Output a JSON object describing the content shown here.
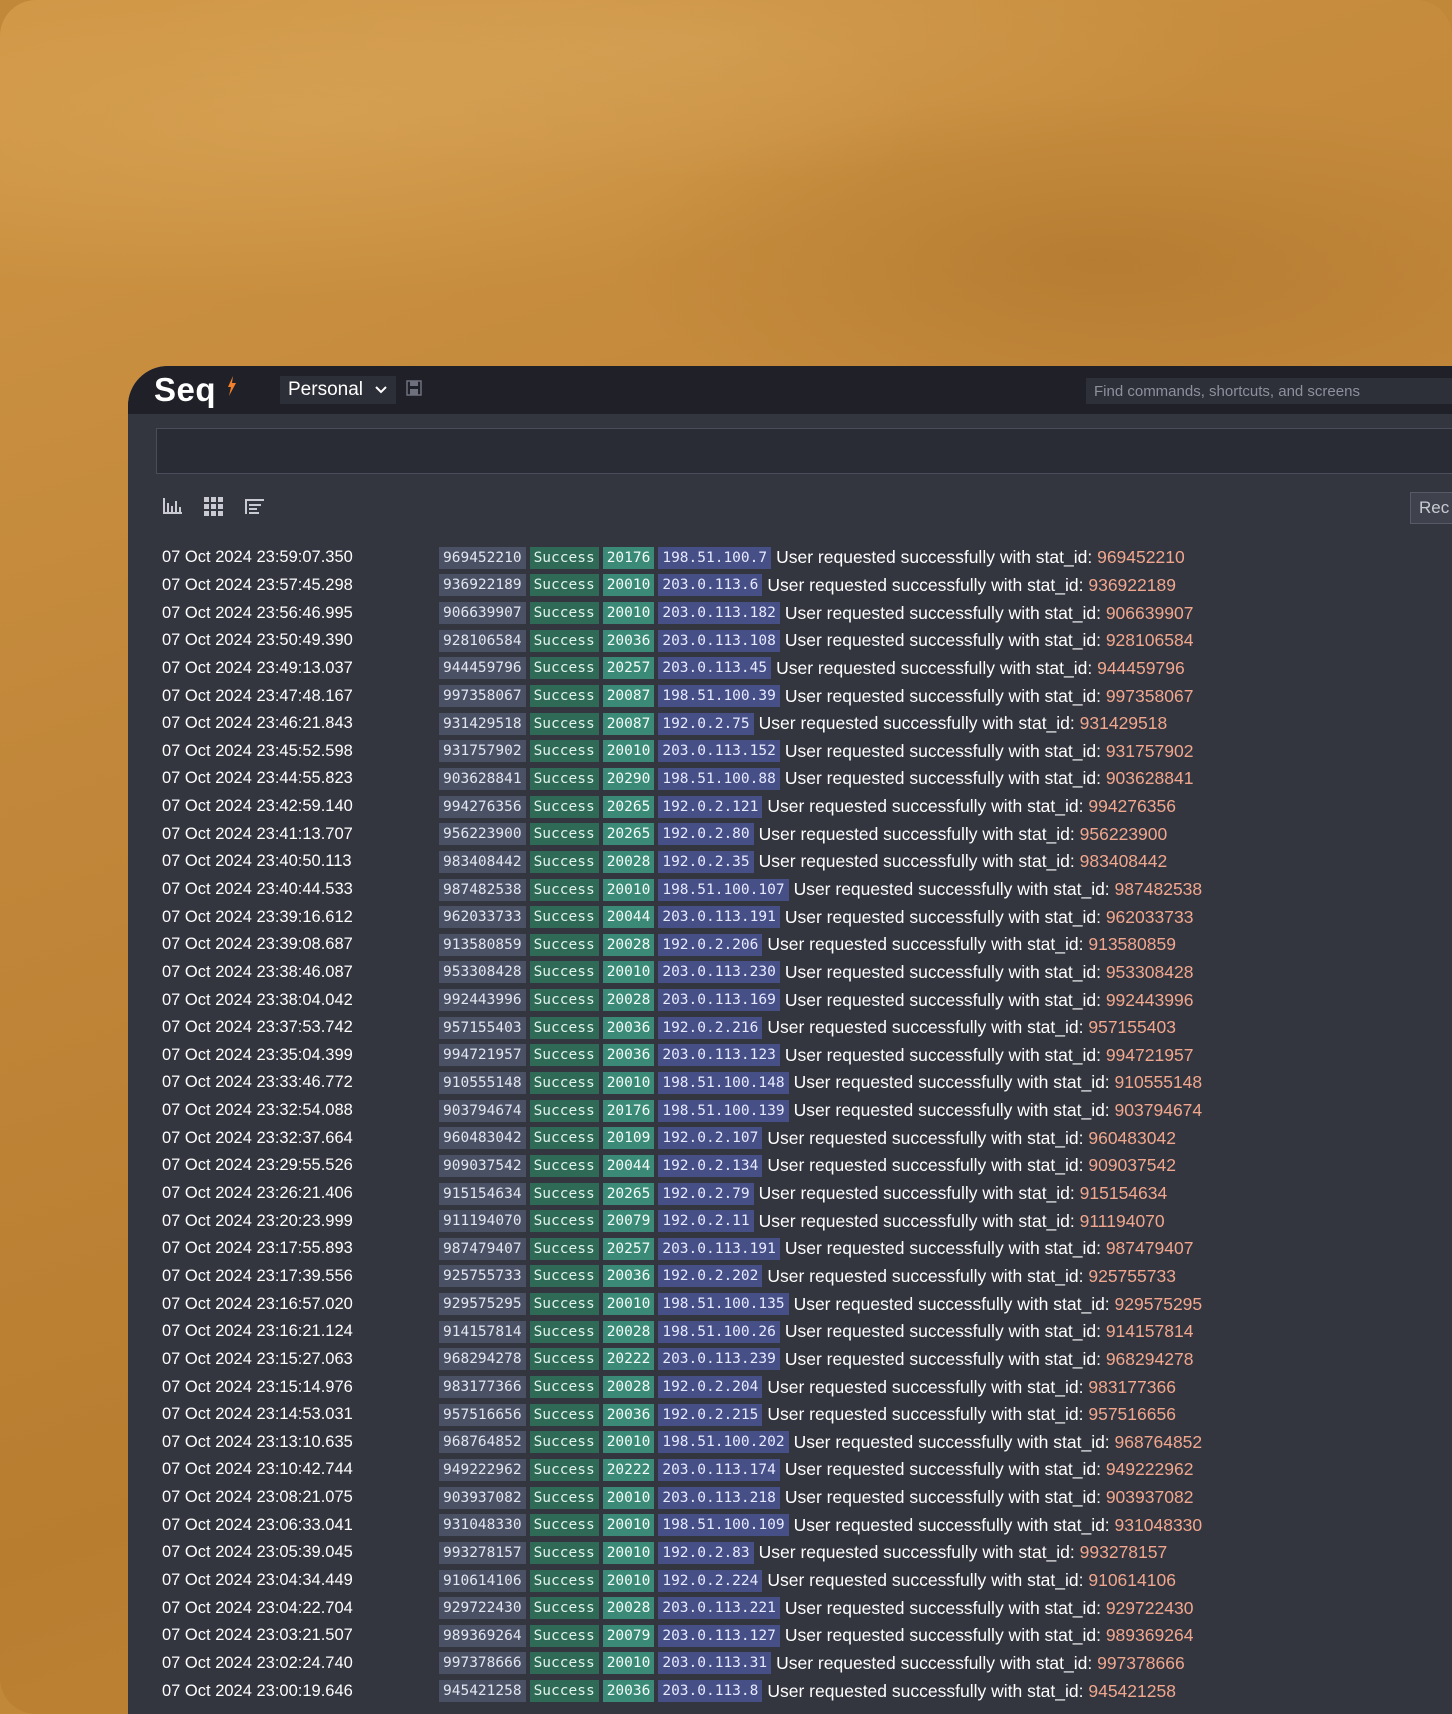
{
  "app": {
    "logo_text": "Seq",
    "workspace": "Personal",
    "search_placeholder": "Find commands, shortcuts, and screens",
    "filter_value": "",
    "rec_label": "Rec"
  },
  "colors": {
    "background": "#c2883a",
    "window": "#33353f",
    "topbar": "#1f2028",
    "id_pill": "#4a5164",
    "status_pill": "#2f6a57",
    "code_pill": "#3b8a77",
    "ip_pill": "#464f86",
    "number_accent": "#f0a78d",
    "logo_accent": "#f2802b"
  },
  "icons": [
    "bar-chart-icon",
    "grid-icon",
    "list-tree-icon",
    "save-icon",
    "chevron-down-icon"
  ],
  "message_prefix": "User requested successfully with stat_id: ",
  "events": [
    {
      "time": "07 Oct 2024  23:59:07.350",
      "id": "969452210",
      "status": "Success",
      "code": "20176",
      "ip": "198.51.100.7"
    },
    {
      "time": "07 Oct 2024  23:57:45.298",
      "id": "936922189",
      "status": "Success",
      "code": "20010",
      "ip": "203.0.113.6"
    },
    {
      "time": "07 Oct 2024  23:56:46.995",
      "id": "906639907",
      "status": "Success",
      "code": "20010",
      "ip": "203.0.113.182"
    },
    {
      "time": "07 Oct 2024  23:50:49.390",
      "id": "928106584",
      "status": "Success",
      "code": "20036",
      "ip": "203.0.113.108"
    },
    {
      "time": "07 Oct 2024  23:49:13.037",
      "id": "944459796",
      "status": "Success",
      "code": "20257",
      "ip": "203.0.113.45"
    },
    {
      "time": "07 Oct 2024  23:47:48.167",
      "id": "997358067",
      "status": "Success",
      "code": "20087",
      "ip": "198.51.100.39"
    },
    {
      "time": "07 Oct 2024  23:46:21.843",
      "id": "931429518",
      "status": "Success",
      "code": "20087",
      "ip": "192.0.2.75"
    },
    {
      "time": "07 Oct 2024  23:45:52.598",
      "id": "931757902",
      "status": "Success",
      "code": "20010",
      "ip": "203.0.113.152"
    },
    {
      "time": "07 Oct 2024  23:44:55.823",
      "id": "903628841",
      "status": "Success",
      "code": "20290",
      "ip": "198.51.100.88"
    },
    {
      "time": "07 Oct 2024  23:42:59.140",
      "id": "994276356",
      "status": "Success",
      "code": "20265",
      "ip": "192.0.2.121"
    },
    {
      "time": "07 Oct 2024  23:41:13.707",
      "id": "956223900",
      "status": "Success",
      "code": "20265",
      "ip": "192.0.2.80"
    },
    {
      "time": "07 Oct 2024  23:40:50.113",
      "id": "983408442",
      "status": "Success",
      "code": "20028",
      "ip": "192.0.2.35"
    },
    {
      "time": "07 Oct 2024  23:40:44.533",
      "id": "987482538",
      "status": "Success",
      "code": "20010",
      "ip": "198.51.100.107"
    },
    {
      "time": "07 Oct 2024  23:39:16.612",
      "id": "962033733",
      "status": "Success",
      "code": "20044",
      "ip": "203.0.113.191"
    },
    {
      "time": "07 Oct 2024  23:39:08.687",
      "id": "913580859",
      "status": "Success",
      "code": "20028",
      "ip": "192.0.2.206"
    },
    {
      "time": "07 Oct 2024  23:38:46.087",
      "id": "953308428",
      "status": "Success",
      "code": "20010",
      "ip": "203.0.113.230"
    },
    {
      "time": "07 Oct 2024  23:38:04.042",
      "id": "992443996",
      "status": "Success",
      "code": "20028",
      "ip": "203.0.113.169"
    },
    {
      "time": "07 Oct 2024  23:37:53.742",
      "id": "957155403",
      "status": "Success",
      "code": "20036",
      "ip": "192.0.2.216"
    },
    {
      "time": "07 Oct 2024  23:35:04.399",
      "id": "994721957",
      "status": "Success",
      "code": "20036",
      "ip": "203.0.113.123"
    },
    {
      "time": "07 Oct 2024  23:33:46.772",
      "id": "910555148",
      "status": "Success",
      "code": "20010",
      "ip": "198.51.100.148"
    },
    {
      "time": "07 Oct 2024  23:32:54.088",
      "id": "903794674",
      "status": "Success",
      "code": "20176",
      "ip": "198.51.100.139"
    },
    {
      "time": "07 Oct 2024  23:32:37.664",
      "id": "960483042",
      "status": "Success",
      "code": "20109",
      "ip": "192.0.2.107"
    },
    {
      "time": "07 Oct 2024  23:29:55.526",
      "id": "909037542",
      "status": "Success",
      "code": "20044",
      "ip": "192.0.2.134"
    },
    {
      "time": "07 Oct 2024  23:26:21.406",
      "id": "915154634",
      "status": "Success",
      "code": "20265",
      "ip": "192.0.2.79"
    },
    {
      "time": "07 Oct 2024  23:20:23.999",
      "id": "911194070",
      "status": "Success",
      "code": "20079",
      "ip": "192.0.2.11"
    },
    {
      "time": "07 Oct 2024  23:17:55.893",
      "id": "987479407",
      "status": "Success",
      "code": "20257",
      "ip": "203.0.113.191"
    },
    {
      "time": "07 Oct 2024  23:17:39.556",
      "id": "925755733",
      "status": "Success",
      "code": "20036",
      "ip": "192.0.2.202"
    },
    {
      "time": "07 Oct 2024  23:16:57.020",
      "id": "929575295",
      "status": "Success",
      "code": "20010",
      "ip": "198.51.100.135"
    },
    {
      "time": "07 Oct 2024  23:16:21.124",
      "id": "914157814",
      "status": "Success",
      "code": "20028",
      "ip": "198.51.100.26"
    },
    {
      "time": "07 Oct 2024  23:15:27.063",
      "id": "968294278",
      "status": "Success",
      "code": "20222",
      "ip": "203.0.113.239"
    },
    {
      "time": "07 Oct 2024  23:15:14.976",
      "id": "983177366",
      "status": "Success",
      "code": "20028",
      "ip": "192.0.2.204"
    },
    {
      "time": "07 Oct 2024  23:14:53.031",
      "id": "957516656",
      "status": "Success",
      "code": "20036",
      "ip": "192.0.2.215"
    },
    {
      "time": "07 Oct 2024  23:13:10.635",
      "id": "968764852",
      "status": "Success",
      "code": "20010",
      "ip": "198.51.100.202"
    },
    {
      "time": "07 Oct 2024  23:10:42.744",
      "id": "949222962",
      "status": "Success",
      "code": "20222",
      "ip": "203.0.113.174"
    },
    {
      "time": "07 Oct 2024  23:08:21.075",
      "id": "903937082",
      "status": "Success",
      "code": "20010",
      "ip": "203.0.113.218"
    },
    {
      "time": "07 Oct 2024  23:06:33.041",
      "id": "931048330",
      "status": "Success",
      "code": "20010",
      "ip": "198.51.100.109"
    },
    {
      "time": "07 Oct 2024  23:05:39.045",
      "id": "993278157",
      "status": "Success",
      "code": "20010",
      "ip": "192.0.2.83"
    },
    {
      "time": "07 Oct 2024  23:04:34.449",
      "id": "910614106",
      "status": "Success",
      "code": "20010",
      "ip": "192.0.2.224"
    },
    {
      "time": "07 Oct 2024  23:04:22.704",
      "id": "929722430",
      "status": "Success",
      "code": "20028",
      "ip": "203.0.113.221"
    },
    {
      "time": "07 Oct 2024  23:03:21.507",
      "id": "989369264",
      "status": "Success",
      "code": "20079",
      "ip": "203.0.113.127"
    },
    {
      "time": "07 Oct 2024  23:02:24.740",
      "id": "997378666",
      "status": "Success",
      "code": "20010",
      "ip": "203.0.113.31"
    },
    {
      "time": "07 Oct 2024  23:00:19.646",
      "id": "945421258",
      "status": "Success",
      "code": "20036",
      "ip": "203.0.113.8"
    }
  ]
}
